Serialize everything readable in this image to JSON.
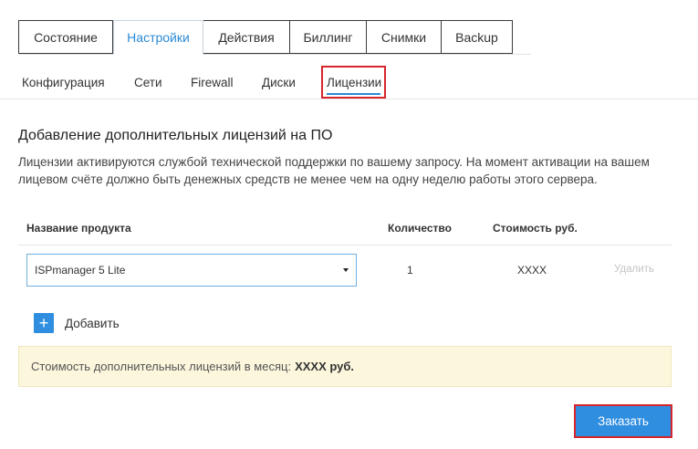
{
  "top_tabs": [
    {
      "label": "Состояние"
    },
    {
      "label": "Настройки"
    },
    {
      "label": "Действия"
    },
    {
      "label": "Биллинг"
    },
    {
      "label": "Снимки"
    },
    {
      "label": "Backup"
    }
  ],
  "top_tabs_active": "Настройки",
  "sub_tabs": [
    {
      "label": "Конфигурация"
    },
    {
      "label": "Сети"
    },
    {
      "label": "Firewall"
    },
    {
      "label": "Диски"
    },
    {
      "label": "Лицензии"
    }
  ],
  "sub_tabs_active": "Лицензии",
  "section": {
    "title": "Добавление дополнительных лицензий на ПО",
    "description": "Лицензии активируются службой технической поддержки по вашему запросу. На момент активации на вашем лицевом счёте должно быть денежных средств не менее чем на одну неделю работы этого сервера."
  },
  "table": {
    "headers": {
      "product": "Название продукта",
      "quantity": "Количество",
      "cost": "Стоимость руб."
    },
    "row": {
      "product": "ISPmanager 5 Lite",
      "quantity": "1",
      "cost": "XXXX",
      "delete": "Удалить"
    }
  },
  "add": {
    "icon": "+",
    "label": "Добавить"
  },
  "notice": {
    "text": "Стоимость дополнительных лицензий в месяц:",
    "amount": "XXXX руб."
  },
  "order_button": "Заказать",
  "colors": {
    "accent": "#2f8ee0",
    "highlight": "#d6262c",
    "notice_bg": "#fbf6dc"
  }
}
